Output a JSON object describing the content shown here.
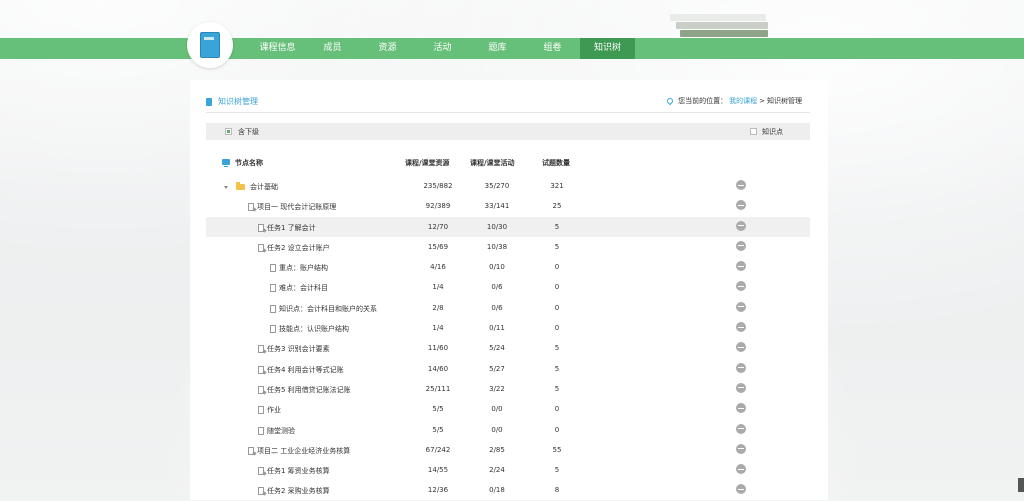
{
  "nav": {
    "items": [
      {
        "label": "课程信息",
        "active": false
      },
      {
        "label": "成员",
        "active": false
      },
      {
        "label": "资源",
        "active": false
      },
      {
        "label": "活动",
        "active": false
      },
      {
        "label": "题库",
        "active": false
      },
      {
        "label": "组卷",
        "active": false
      },
      {
        "label": "知识树",
        "active": true
      }
    ]
  },
  "page": {
    "title": "知识树管理",
    "breadcrumb_prefix": "您当前的位置：",
    "breadcrumb_link": "我的课程",
    "breadcrumb_sep": ">",
    "breadcrumb_current": "知识树管理"
  },
  "filter": {
    "include_sub_label": "含下级",
    "include_sub_checked": true,
    "knowledge_point_label": "知识点",
    "knowledge_point_checked": false
  },
  "table": {
    "headers": [
      "节点名称",
      "课程/课堂资源",
      "课程/课堂活动",
      "试题数量"
    ],
    "rows": [
      {
        "name": "会计基础",
        "level": 0,
        "icon": "folder",
        "res": "235/882",
        "act": "35/270",
        "qty": "321"
      },
      {
        "name": "项目一 现代会计记账原理",
        "level": 1,
        "icon": "file-edit",
        "res": "92/389",
        "act": "33/141",
        "qty": "25"
      },
      {
        "name": "任务1 了解会计",
        "level": 2,
        "icon": "file-edit",
        "res": "12/70",
        "act": "10/30",
        "qty": "5",
        "highlight": true
      },
      {
        "name": "任务2 设立会计账户",
        "level": 2,
        "icon": "file-edit",
        "res": "15/69",
        "act": "10/38",
        "qty": "5"
      },
      {
        "name": "重点：账户结构",
        "level": 3,
        "icon": "file",
        "res": "4/16",
        "act": "0/10",
        "qty": "0"
      },
      {
        "name": "难点：会计科目",
        "level": 3,
        "icon": "file",
        "res": "1/4",
        "act": "0/6",
        "qty": "0"
      },
      {
        "name": "知识点：会计科目和账户的关系",
        "level": 3,
        "icon": "file",
        "res": "2/8",
        "act": "0/6",
        "qty": "0"
      },
      {
        "name": "技能点：认识账户结构",
        "level": 3,
        "icon": "file",
        "res": "1/4",
        "act": "0/11",
        "qty": "0"
      },
      {
        "name": "任务3 识别会计要素",
        "level": 2,
        "icon": "file-edit",
        "res": "11/60",
        "act": "5/24",
        "qty": "5"
      },
      {
        "name": "任务4 利用会计等式记账",
        "level": 2,
        "icon": "file-edit",
        "res": "14/60",
        "act": "5/27",
        "qty": "5"
      },
      {
        "name": "任务5 利用借贷记账法记账",
        "level": 2,
        "icon": "file-edit",
        "res": "25/111",
        "act": "3/22",
        "qty": "5"
      },
      {
        "name": "作业",
        "level": 2,
        "icon": "file",
        "res": "5/5",
        "act": "0/0",
        "qty": "0"
      },
      {
        "name": "随堂测验",
        "level": 2,
        "icon": "file",
        "res": "5/5",
        "act": "0/0",
        "qty": "0"
      },
      {
        "name": "项目二 工业企业经济业务核算",
        "level": 1,
        "icon": "file-edit",
        "res": "67/242",
        "act": "2/85",
        "qty": "55"
      },
      {
        "name": "任务1 筹资业务核算",
        "level": 2,
        "icon": "file-edit",
        "res": "14/55",
        "act": "2/24",
        "qty": "5"
      },
      {
        "name": "任务2 采购业务核算",
        "level": 2,
        "icon": "file-edit",
        "res": "12/36",
        "act": "0/18",
        "qty": "8"
      }
    ]
  },
  "colors": {
    "nav_green": "#67c079",
    "nav_active": "#3e9a52",
    "accent_blue": "#3aa3d8"
  }
}
